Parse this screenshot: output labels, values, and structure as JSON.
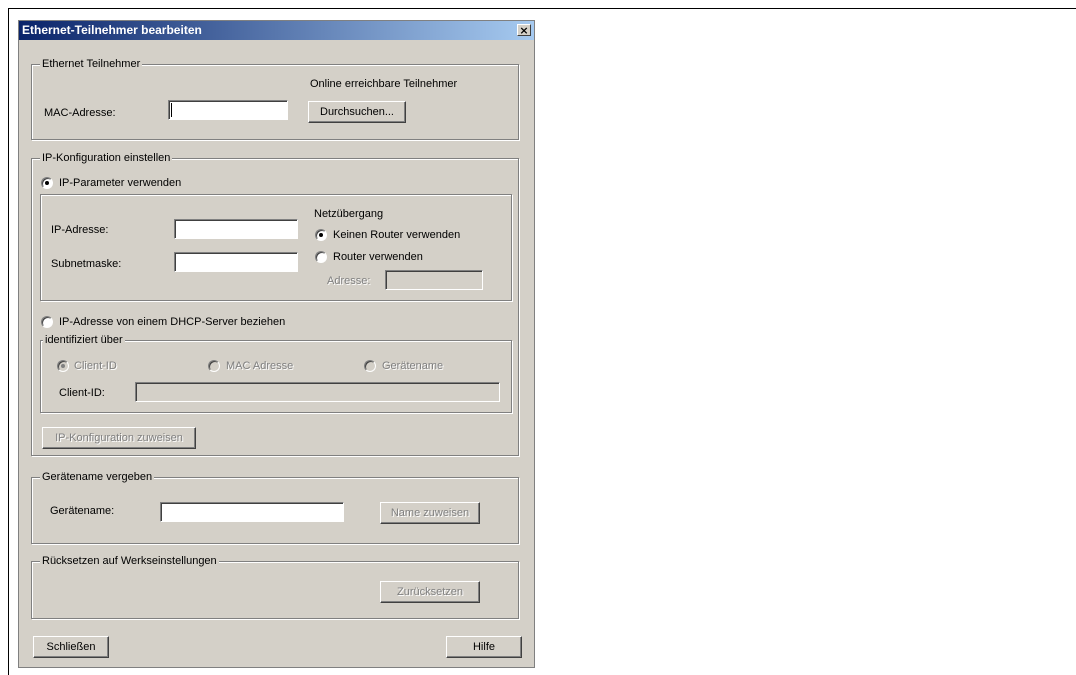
{
  "dialog": {
    "title": "Ethernet-Teilnehmer bearbeiten",
    "close_glyph": "×"
  },
  "ethernet_group": {
    "legend": "Ethernet Teilnehmer",
    "online_label": "Online erreichbare Teilnehmer",
    "mac_label": "MAC-Adresse:",
    "mac_value": "",
    "browse_button": "Durchsuchen..."
  },
  "ip_group": {
    "legend": "IP-Konfiguration einstellen",
    "use_ip_params_label": "IP-Parameter verwenden",
    "use_ip_params_selected": true,
    "ip_label": "IP-Adresse:",
    "ip_value": "",
    "subnet_label": "Subnetmaske:",
    "subnet_value": "",
    "gateway": {
      "title": "Netzübergang",
      "no_router_label": "Keinen Router verwenden",
      "no_router_selected": true,
      "use_router_label": "Router verwenden",
      "use_router_selected": false,
      "address_label": "Adresse:",
      "address_value": ""
    },
    "dhcp_label": "IP-Adresse von einem DHCP-Server beziehen",
    "dhcp_selected": false,
    "identified_by": {
      "legend": "identifiziert über",
      "client_id_radio": "Client-ID",
      "mac_radio": "MAC Adresse",
      "device_name_radio": "Gerätename",
      "client_id_label": "Client-ID:",
      "client_id_value": ""
    },
    "assign_button": "IP-Konfiguration zuweisen"
  },
  "device_name_group": {
    "legend": "Gerätename vergeben",
    "label": "Gerätename:",
    "value": "",
    "assign_button": "Name zuweisen"
  },
  "reset_group": {
    "legend": "Rücksetzen auf Werkseinstellungen",
    "reset_button": "Zurücksetzen"
  },
  "footer": {
    "close_button": "Schließen",
    "help_button": "Hilfe"
  }
}
